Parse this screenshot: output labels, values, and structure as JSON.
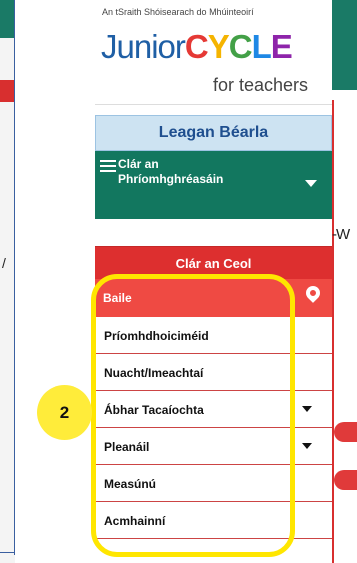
{
  "logo": {
    "tagline": "An tSraith Shóisearach do Mhúinteoirí",
    "junior": "Junior",
    "cycle_letters": [
      "C",
      "Y",
      "C",
      "L",
      "E"
    ],
    "sub": "for teachers"
  },
  "language_button": "Leagan Béarla",
  "main_menu": {
    "label": "Clár an Phríomhghréasáin"
  },
  "music_button": "Clár an Ceol",
  "home": {
    "label": "Baile"
  },
  "menu_items": [
    {
      "label": "Príomhdhoiciméid",
      "has_dropdown": false
    },
    {
      "label": "Nuacht/Imeachtaí",
      "has_dropdown": false
    },
    {
      "label": "Ábhar Tacaíochta",
      "has_dropdown": true
    },
    {
      "label": "Pleanáil",
      "has_dropdown": true
    },
    {
      "label": "Measúnú",
      "has_dropdown": false
    },
    {
      "label": "Acmhainní",
      "has_dropdown": false
    }
  ],
  "annotation": {
    "badge_number": "2"
  },
  "colors": {
    "teal": "#12775f",
    "red": "#dd2f2f",
    "highlight": "#ffe600",
    "accent_blue": "#1f4f8f"
  }
}
